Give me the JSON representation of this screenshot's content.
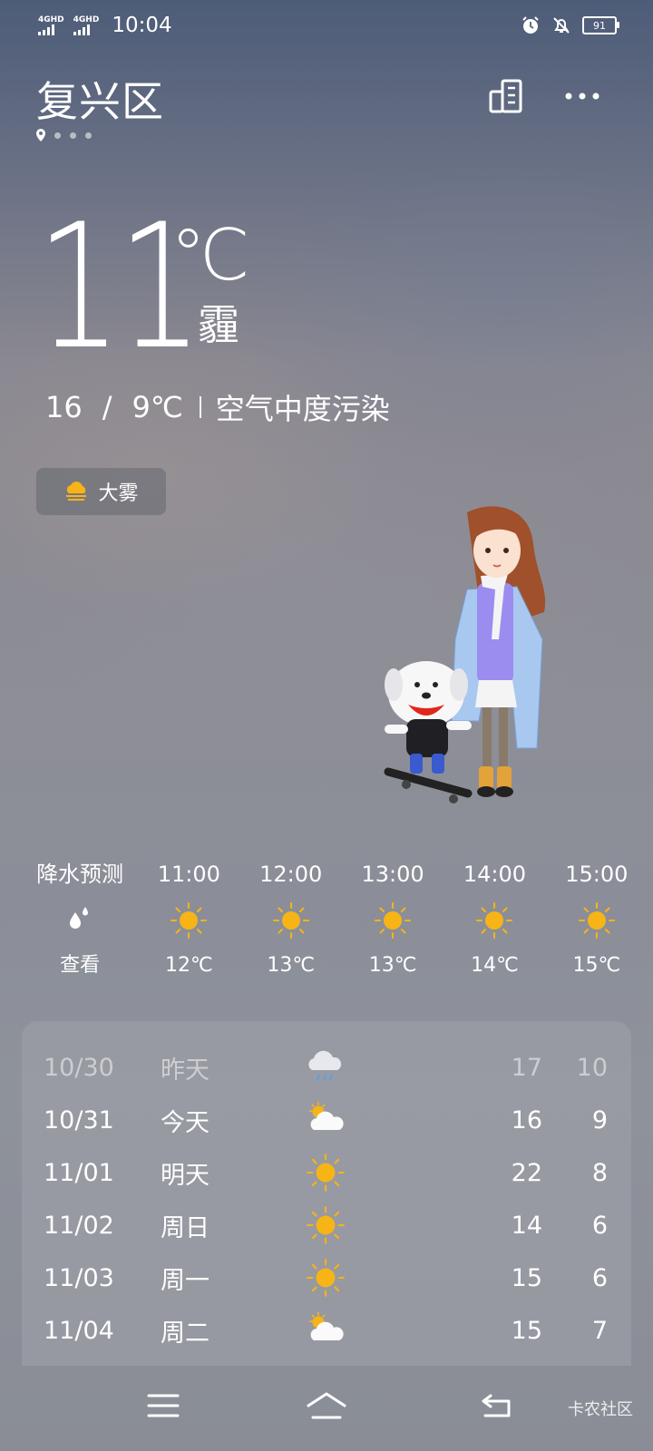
{
  "status_bar": {
    "network1": "4GHD",
    "network2": "4GHD",
    "time": "10:04",
    "battery": "91",
    "icons": [
      "alarm-icon",
      "bell-muted-icon",
      "battery-icon"
    ]
  },
  "header": {
    "city": "复兴区",
    "icons": [
      "city-manage-icon",
      "more-icon"
    ]
  },
  "current": {
    "temperature": "11",
    "unit": "℃",
    "condition": "霾",
    "high": "16",
    "slash": "/",
    "low": "9℃",
    "air_quality": "空气中度污染",
    "alert_badge": "大雾",
    "alert_icon": "fog-icon"
  },
  "hourly": {
    "precip_label": "降水预测",
    "precip_icon": "raindrop-icon",
    "precip_action": "查看",
    "items": [
      {
        "time": "11:00",
        "icon": "sun-icon",
        "temp": "12℃"
      },
      {
        "time": "12:00",
        "icon": "sun-icon",
        "temp": "13℃"
      },
      {
        "time": "13:00",
        "icon": "sun-icon",
        "temp": "13℃"
      },
      {
        "time": "14:00",
        "icon": "sun-icon",
        "temp": "14℃"
      },
      {
        "time": "15:00",
        "icon": "sun-icon",
        "temp": "15℃"
      }
    ]
  },
  "daily": [
    {
      "date": "10/30",
      "day": "昨天",
      "icon": "cloud-rain-icon",
      "high": "17",
      "low": "10"
    },
    {
      "date": "10/31",
      "day": "今天",
      "icon": "partly-cloudy-icon",
      "high": "16",
      "low": "9"
    },
    {
      "date": "11/01",
      "day": "明天",
      "icon": "sun-icon",
      "high": "22",
      "low": "8"
    },
    {
      "date": "11/02",
      "day": "周日",
      "icon": "sun-icon",
      "high": "14",
      "low": "6"
    },
    {
      "date": "11/03",
      "day": "周一",
      "icon": "sun-icon",
      "high": "15",
      "low": "6"
    },
    {
      "date": "11/04",
      "day": "周二",
      "icon": "partly-cloudy-icon",
      "high": "15",
      "low": "7"
    }
  ],
  "nav": {
    "icons": [
      "menu-icon",
      "home-icon",
      "back-icon"
    ]
  },
  "watermark": "卡农社区",
  "colors": {
    "sun": "#f6b417",
    "text": "#ffffff"
  }
}
